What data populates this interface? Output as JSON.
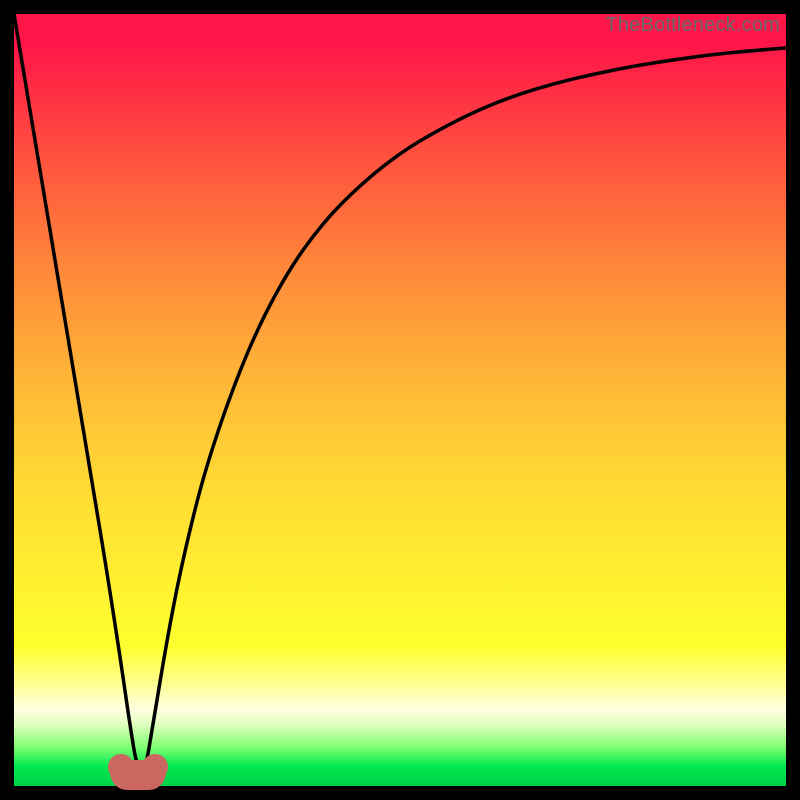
{
  "watermark": "TheBottleneck.com",
  "colors": {
    "watermark": "#6a6a6a",
    "background": "#000000",
    "curve": "#000000",
    "bump": "#cc6660"
  },
  "chart_data": {
    "type": "line",
    "title": "",
    "xlabel": "",
    "ylabel": "",
    "xlim": [
      0,
      100
    ],
    "ylim": [
      0,
      100
    ],
    "grid": false,
    "series": [
      {
        "name": "curve",
        "x": [
          0,
          2,
          4,
          6,
          8,
          10,
          12,
          14,
          15,
          16,
          17,
          18,
          20,
          22,
          25,
          30,
          35,
          40,
          45,
          50,
          55,
          60,
          65,
          70,
          75,
          80,
          85,
          90,
          95,
          100
        ],
        "y": [
          100,
          88,
          76,
          64,
          52,
          40,
          28,
          15,
          8,
          2,
          2,
          8,
          20,
          30,
          42,
          56,
          66,
          73,
          78,
          82,
          85,
          87.5,
          89.5,
          91,
          92.2,
          93.2,
          94,
          94.7,
          95.2,
          95.6
        ]
      }
    ],
    "annotations": [
      {
        "name": "bump",
        "x": 16,
        "y": 1
      }
    ]
  }
}
